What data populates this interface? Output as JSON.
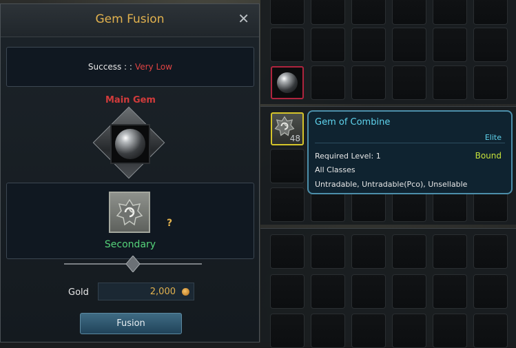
{
  "window": {
    "title": "Gem Fusion",
    "close_glyph": "✕"
  },
  "success": {
    "label": "Success : :",
    "value": "Very Low",
    "value_color": "#e24444"
  },
  "main_gem": {
    "label": "Main Gem",
    "icon": "silver-orb-gem-icon"
  },
  "secondary": {
    "label": "Secondary",
    "unknown_mark": "?",
    "icon": "gem-of-combine-icon"
  },
  "gold": {
    "label": "Gold",
    "value": "2,000",
    "icon": "gold-coin-icon"
  },
  "fusion_button": {
    "label": "Fusion"
  },
  "inventory": {
    "combine_count": "48"
  },
  "tooltip": {
    "name": "Gem of Combine",
    "grade": "Elite",
    "required_level": "Required Level: 1",
    "bind_status": "Bound",
    "classes": "All Classes",
    "trade_info": "Untradable, Untradable(Pco), Unsellable"
  },
  "colors": {
    "title_gold": "#e2b24e",
    "main_gem_red": "#d23b3b",
    "secondary_green": "#55d37a",
    "tooltip_cyan": "#5fd4ee",
    "bound_yellow_green": "#c7e33a",
    "selected_slot_border": "#d6c52a"
  }
}
